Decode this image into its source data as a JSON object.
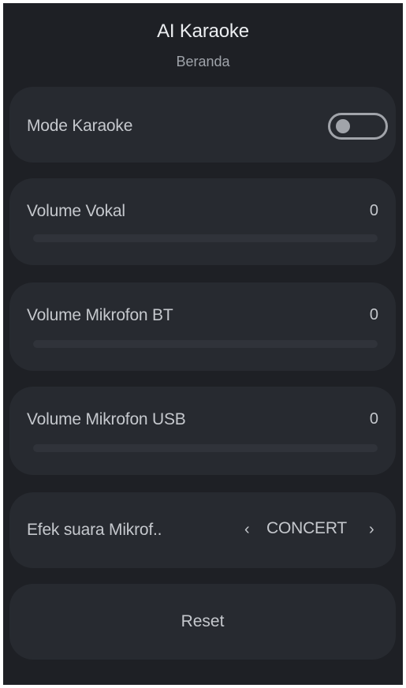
{
  "header": {
    "title": "AI Karaoke",
    "subtitle": "Beranda"
  },
  "karaoke_mode": {
    "label": "Mode Karaoke",
    "enabled": false
  },
  "volume_vokal": {
    "label": "Volume Vokal",
    "value": "0",
    "level": 0
  },
  "volume_mic_bt": {
    "label": "Volume Mikrofon BT",
    "value": "0",
    "level": 0
  },
  "volume_mic_usb": {
    "label": "Volume Mikrofon USB",
    "value": "0",
    "level": 0
  },
  "mic_effect": {
    "label": "Efek suara Mikrof..",
    "prev_glyph": "‹",
    "value": "CONCERT",
    "next_glyph": "›"
  },
  "reset": {
    "label": "Reset"
  },
  "colors": {
    "background": "#1e2025",
    "card": "#272a30",
    "track": "#30333a",
    "toggle_off": "#a1a4aa"
  }
}
